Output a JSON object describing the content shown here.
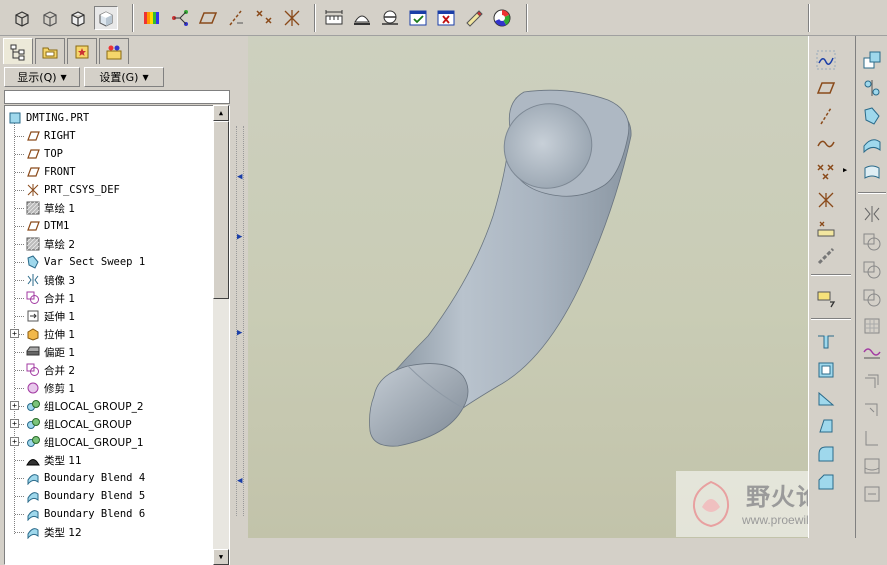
{
  "toolbar": {
    "icons": [
      "wireframe-view-icon",
      "hidden-line-view-icon",
      "no-hidden-view-icon",
      "shaded-view-icon",
      "color-appearance-icon",
      "datum-display-icon",
      "datum-plane-display-icon",
      "datum-axis-display-icon",
      "datum-point-display-icon",
      "datum-csys-display-icon",
      "measure-icon",
      "section-icon",
      "analysis-icon",
      "edit-window-icon",
      "close-window-icon",
      "render-icon",
      "appearance-icon"
    ]
  },
  "left_panel": {
    "display_menu": "显示(Q)",
    "settings_menu": "设置(G)",
    "tree": [
      {
        "label": "DMTING.PRT",
        "icon": "part-icon",
        "level": 0
      },
      {
        "label": "RIGHT",
        "icon": "datum-plane-icon",
        "level": 1
      },
      {
        "label": "TOP",
        "icon": "datum-plane-icon",
        "level": 1
      },
      {
        "label": "FRONT",
        "icon": "datum-plane-icon",
        "level": 1
      },
      {
        "label": "PRT_CSYS_DEF",
        "icon": "csys-icon",
        "level": 1
      },
      {
        "label": "草绘 1",
        "icon": "sketch-icon",
        "level": 1
      },
      {
        "label": "DTM1",
        "icon": "datum-plane-icon",
        "level": 1
      },
      {
        "label": "草绘 2",
        "icon": "sketch-icon",
        "level": 1
      },
      {
        "label": "Var Sect Sweep 1",
        "icon": "sweep-icon",
        "level": 1
      },
      {
        "label": "镜像 3",
        "icon": "mirror-icon",
        "level": 1
      },
      {
        "label": "合并 1",
        "icon": "merge-icon",
        "level": 1
      },
      {
        "label": "延伸 1",
        "icon": "extend-icon",
        "level": 1
      },
      {
        "label": "拉伸 1",
        "icon": "extrude-icon",
        "level": 1,
        "expandable": true
      },
      {
        "label": "偏距 1",
        "icon": "offset-icon",
        "level": 1
      },
      {
        "label": "合并 2",
        "icon": "merge-icon",
        "level": 1
      },
      {
        "label": "修剪 1",
        "icon": "trim-icon",
        "level": 1
      },
      {
        "label": "组LOCAL_GROUP_2",
        "icon": "group-icon",
        "level": 1,
        "expandable": true
      },
      {
        "label": "组LOCAL_GROUP",
        "icon": "group-icon",
        "level": 1,
        "expandable": true
      },
      {
        "label": "组LOCAL_GROUP_1",
        "icon": "group-icon",
        "level": 1,
        "expandable": true
      },
      {
        "label": "类型 11",
        "icon": "type-feature-icon",
        "level": 1
      },
      {
        "label": "Boundary Blend 4",
        "icon": "boundary-blend-icon",
        "level": 1
      },
      {
        "label": "Boundary Blend 5",
        "icon": "boundary-blend-icon",
        "level": 1
      },
      {
        "label": "Boundary Blend 6",
        "icon": "boundary-blend-icon",
        "level": 1
      },
      {
        "label": "类型 12",
        "icon": "boundary-blend-icon",
        "level": 1
      }
    ]
  },
  "watermark": {
    "title": "野火论坛",
    "url": "www.proewildfire.cn"
  },
  "colors": {
    "window_bg": "#d4d0c8",
    "model_surface": "#a9b4c0",
    "viewport_bg": "#c9ccb5",
    "splitter_arrow": "#1a3ea8"
  }
}
